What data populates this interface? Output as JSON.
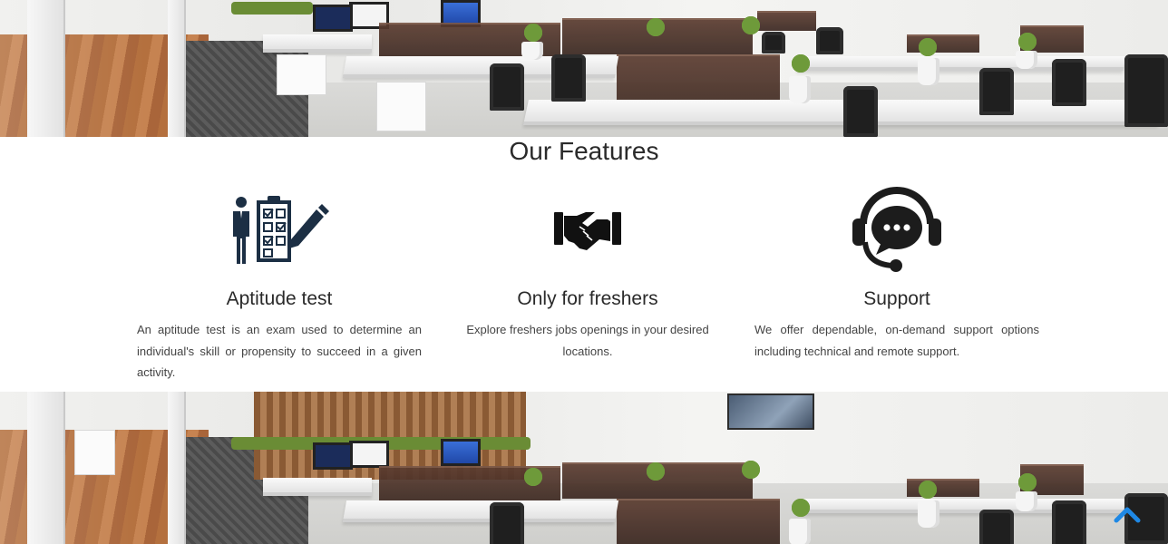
{
  "section": {
    "title": "Our Features"
  },
  "features": [
    {
      "icon": "aptitude-checklist-icon",
      "title": "Aptitude test",
      "description": "An aptitude test is an exam used to determine an individual's skill or propensity to succeed in a given activity."
    },
    {
      "icon": "handshake-icon",
      "title": "Only for freshers",
      "description": "Explore freshers jobs openings in your desired locations."
    },
    {
      "icon": "headset-support-icon",
      "title": "Support",
      "description": "We offer dependable, on-demand support options including technical and remote support."
    }
  ],
  "scroll_top": {
    "icon": "chevron-up-icon",
    "color": "#1e88e5"
  },
  "colors": {
    "icon_dark": "#1c2f44",
    "icon_black": "#111111",
    "text": "#444444"
  }
}
